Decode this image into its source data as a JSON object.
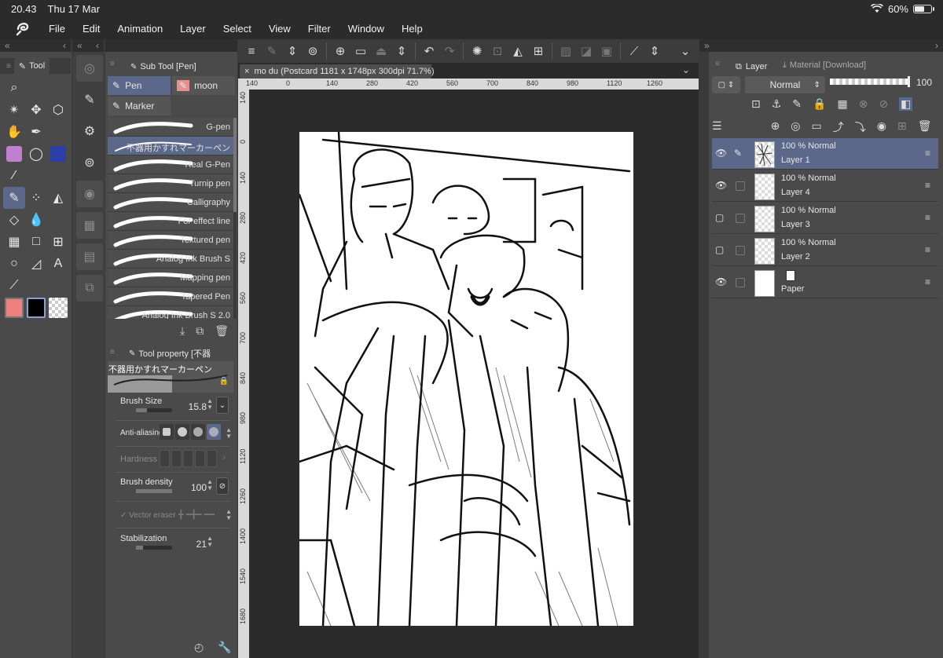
{
  "status": {
    "time": "20.43",
    "date": "Thu 17 Mar",
    "battery": "60%",
    "battery_level": 0.6
  },
  "menu": [
    "File",
    "Edit",
    "Animation",
    "Layer",
    "Select",
    "View",
    "Filter",
    "Window",
    "Help"
  ],
  "tool_panel": {
    "tab": "Tool"
  },
  "sub_tool": {
    "tab": "Sub Tool [Pen]",
    "groups": [
      {
        "label": "Pen",
        "active": true
      },
      {
        "label": "moon",
        "active": false
      },
      {
        "label": "Marker",
        "active": false
      }
    ],
    "brushes": [
      {
        "name": "G-pen",
        "active": false
      },
      {
        "name": "不器用かすれマーカーペン",
        "active": true
      },
      {
        "name": "Real G-Pen",
        "active": false
      },
      {
        "name": "Turnip pen",
        "active": false
      },
      {
        "name": "Calligraphy",
        "active": false
      },
      {
        "name": "For effect line",
        "active": false
      },
      {
        "name": "Textured pen",
        "active": false
      },
      {
        "name": "Analog Ink Brush S",
        "active": false
      },
      {
        "name": "Mapping pen",
        "active": false
      },
      {
        "name": "Tapered Pen",
        "active": false
      },
      {
        "name": "Analog Ink Brush S 2.0",
        "active": false
      }
    ]
  },
  "tool_property": {
    "tab": "Tool property [不器",
    "brush_name": "不器用かすれマーカーペン",
    "brush_size_label": "Brush Size",
    "brush_size": "15.8",
    "brush_size_level": 0.3,
    "anti_aliasing_label": "Anti-aliasing",
    "hardness_label": "Hardness",
    "density_label": "Brush density",
    "density": "100",
    "density_level": 1.0,
    "vector_eraser_label": "Vector eraser",
    "stabilization_label": "Stabilization",
    "stabilization": "21",
    "stabilization_level": 0.2
  },
  "document": {
    "tab_title": "mo du (Postcard 1181 x 1748px 300dpi 71.7%)"
  },
  "ruler": {
    "h_ticks": [
      "140",
      "0",
      "140",
      "280",
      "420",
      "560",
      "700",
      "840",
      "980",
      "1120",
      "1260"
    ],
    "v_ticks": [
      "140",
      "0",
      "140",
      "280",
      "420",
      "560",
      "700",
      "840",
      "980",
      "1120",
      "1260",
      "1400",
      "1540",
      "1680"
    ]
  },
  "layer_panel": {
    "tab": "Layer",
    "material_tab": "Material [Download]",
    "blend_mode": "Normal",
    "opacity": "100",
    "layers": [
      {
        "opacity": "100 %",
        "mode": "Normal",
        "name": "Layer 1",
        "visible": true,
        "active": true,
        "type": "sketch"
      },
      {
        "opacity": "100 %",
        "mode": "Normal",
        "name": "Layer 4",
        "visible": true,
        "active": false,
        "type": "transparent"
      },
      {
        "opacity": "100 %",
        "mode": "Normal",
        "name": "Layer 3",
        "visible": false,
        "active": false,
        "type": "transparent"
      },
      {
        "opacity": "100 %",
        "mode": "Normal",
        "name": "Layer 2",
        "visible": false,
        "active": false,
        "type": "transparent"
      },
      {
        "opacity": "",
        "mode": "",
        "name": "Paper",
        "visible": true,
        "active": false,
        "type": "paper"
      }
    ]
  },
  "colors": {
    "accent": "#5c6889",
    "main_color": "#f08080",
    "sub_color": "#000000"
  }
}
